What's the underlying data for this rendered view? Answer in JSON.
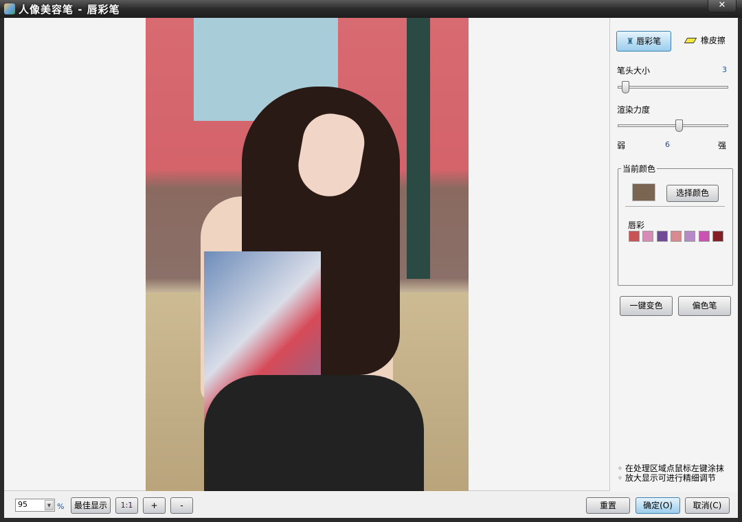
{
  "window": {
    "title": "人像美容笔 - 唇彩笔",
    "close": "✕"
  },
  "tools": {
    "lip_pen": "唇彩笔",
    "eraser": "橡皮擦"
  },
  "brush_size": {
    "label": "笔头大小",
    "value": "3",
    "fraction": 0.04
  },
  "intensity": {
    "label": "渲染力度",
    "value": "6",
    "fraction": 0.56,
    "min_label": "弱",
    "max_label": "强"
  },
  "current_color": {
    "title": "当前颜色",
    "color": "#7a6552",
    "choose_button": "选择颜色",
    "palette_label": "唇彩",
    "palette": [
      "#c95457",
      "#d88bb6",
      "#704a97",
      "#d98a8e",
      "#b689c7",
      "#c953b2",
      "#821e24"
    ]
  },
  "actions": {
    "one_key": "一键变色",
    "tint_pen": "偏色笔"
  },
  "tips": [
    "在处理区域点鼠标左键涂抹",
    "放大显示可进行精细调节"
  ],
  "bottom": {
    "zoom_value": "95",
    "percent": "%",
    "best_fit": "最佳显示",
    "one_to_one": "1:1",
    "zoom_in": "+",
    "zoom_out": "-",
    "reset": "重置",
    "ok": "确定(O)",
    "cancel": "取消(C)"
  }
}
